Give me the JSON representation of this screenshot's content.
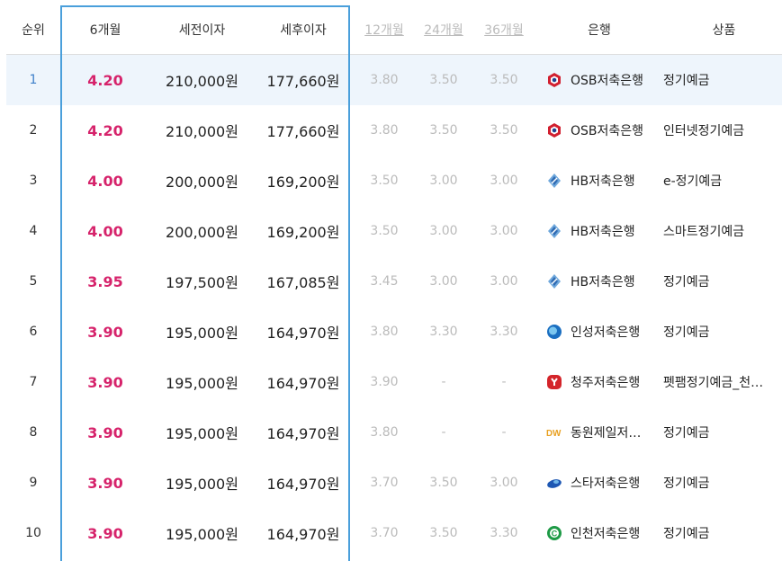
{
  "colors": {
    "accent": "#4a9fdb",
    "rate_red": "#d6236b",
    "muted": "#bbbbbb",
    "selected_row_bg": "#eef5fc"
  },
  "headers": {
    "rank": "순위",
    "m6": "6개월",
    "pre_tax": "세전이자",
    "post_tax": "세후이자",
    "m12": "12개월",
    "m24": "24개월",
    "m36": "36개월",
    "bank": "은행",
    "product": "상품"
  },
  "rows": [
    {
      "rank": "1",
      "m6": "4.20",
      "pre_tax": "210,000원",
      "post_tax": "177,660원",
      "m12": "3.80",
      "m24": "3.50",
      "m36": "3.50",
      "bank": "OSB저축은행",
      "logo": "osb-logo-icon",
      "product": "정기예금"
    },
    {
      "rank": "2",
      "m6": "4.20",
      "pre_tax": "210,000원",
      "post_tax": "177,660원",
      "m12": "3.80",
      "m24": "3.50",
      "m36": "3.50",
      "bank": "OSB저축은행",
      "logo": "osb-logo-icon",
      "product": "인터넷정기예금"
    },
    {
      "rank": "3",
      "m6": "4.00",
      "pre_tax": "200,000원",
      "post_tax": "169,200원",
      "m12": "3.50",
      "m24": "3.00",
      "m36": "3.00",
      "bank": "HB저축은행",
      "logo": "hb-logo-icon",
      "product": "e-정기예금"
    },
    {
      "rank": "4",
      "m6": "4.00",
      "pre_tax": "200,000원",
      "post_tax": "169,200원",
      "m12": "3.50",
      "m24": "3.00",
      "m36": "3.00",
      "bank": "HB저축은행",
      "logo": "hb-logo-icon",
      "product": "스마트정기예금"
    },
    {
      "rank": "5",
      "m6": "3.95",
      "pre_tax": "197,500원",
      "post_tax": "167,085원",
      "m12": "3.45",
      "m24": "3.00",
      "m36": "3.00",
      "bank": "HB저축은행",
      "logo": "hb-logo-icon",
      "product": "정기예금"
    },
    {
      "rank": "6",
      "m6": "3.90",
      "pre_tax": "195,000원",
      "post_tax": "164,970원",
      "m12": "3.80",
      "m24": "3.30",
      "m36": "3.30",
      "bank": "인성저축은행",
      "logo": "insung-logo-icon",
      "product": "정기예금"
    },
    {
      "rank": "7",
      "m6": "3.90",
      "pre_tax": "195,000원",
      "post_tax": "164,970원",
      "m12": "3.90",
      "m24": "-",
      "m36": "-",
      "bank": "청주저축은행",
      "logo": "cheongju-logo-icon",
      "product": "펫팸정기예금_천…"
    },
    {
      "rank": "8",
      "m6": "3.90",
      "pre_tax": "195,000원",
      "post_tax": "164,970원",
      "m12": "3.80",
      "m24": "-",
      "m36": "-",
      "bank": "동원제일저…",
      "logo": "dw-logo-icon",
      "product": "정기예금"
    },
    {
      "rank": "9",
      "m6": "3.90",
      "pre_tax": "195,000원",
      "post_tax": "164,970원",
      "m12": "3.70",
      "m24": "3.50",
      "m36": "3.00",
      "bank": "스타저축은행",
      "logo": "star-logo-icon",
      "product": "정기예금"
    },
    {
      "rank": "10",
      "m6": "3.90",
      "pre_tax": "195,000원",
      "post_tax": "164,970원",
      "m12": "3.70",
      "m24": "3.50",
      "m36": "3.30",
      "bank": "인천저축은행",
      "logo": "incheon-logo-icon",
      "product": "정기예금"
    }
  ]
}
